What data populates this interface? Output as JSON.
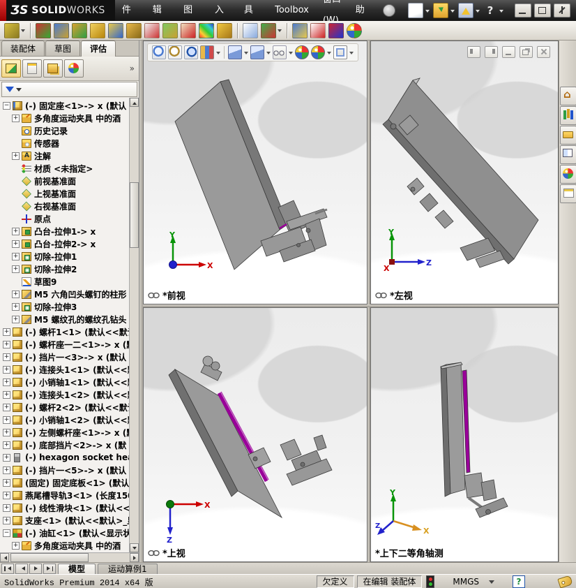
{
  "title_bar": {
    "logo_mark": "ƷS",
    "brand_bold": "SOLID",
    "brand_light": "WORKS",
    "menu_items": [
      "文件(F)",
      "编辑(E)",
      "视图(V)",
      "插入(I)",
      "工具(T)",
      "Toolbox",
      "窗口(W)",
      "帮助(H)"
    ],
    "pin_icon": "search-pin-icon",
    "quick_icons": [
      {
        "name": "new-document-icon",
        "cls": "qk-new",
        "dropdown": true
      },
      {
        "name": "open-document-icon",
        "cls": "qk-open",
        "dropdown": true
      },
      {
        "name": "options-warning-icon",
        "cls": "qk-warn",
        "dropdown": true
      },
      {
        "name": "help-icon",
        "cls": "qk-help",
        "glyph": "?",
        "dropdown": true
      }
    ],
    "window_buttons": [
      "minimize-icon",
      "maximize-icon",
      "close-icon"
    ]
  },
  "command_toolbar": {
    "icons": [
      {
        "name": "interchange-keys-icon",
        "c1": "#d8c040",
        "c2": "#8a7a20",
        "dropdown": true
      },
      {
        "name": "interference-detection-icon",
        "c1": "#cc3333",
        "c2": "#33aa33",
        "sep_before": true
      },
      {
        "name": "clearance-verification-icon",
        "c1": "#4a7ad0",
        "c2": "#c8a030"
      },
      {
        "name": "hole-alignment-icon",
        "c1": "#d8a030",
        "c2": "#2f9e44"
      },
      {
        "name": "measure-icon",
        "c1": "#f0d060",
        "c2": "#b8860b"
      },
      {
        "name": "mass-properties-icon",
        "c1": "#e8c84a",
        "c2": "#3366cc"
      },
      {
        "name": "section-properties-icon",
        "c1": "#e8b84a",
        "c2": "#8a6a18"
      },
      {
        "name": "performance-evaluation-icon",
        "c1": "#f0f0f0",
        "c2": "#cc3333"
      },
      {
        "name": "assembly-xpert-icon",
        "c1": "#80c860",
        "c2": "#c8a030"
      },
      {
        "name": "simulation-xpert-icon",
        "c1": "#f0e0c0",
        "c2": "#cc2222"
      },
      {
        "name": "curvature-icon",
        "special": "tb-rainbow"
      },
      {
        "name": "check-document-bell-icon",
        "c1": "#f0c840",
        "c2": "#a87818"
      },
      {
        "name": "compare-documents-icon",
        "c1": "#ffffff",
        "c2": "#88aadd",
        "sep_before": true
      },
      {
        "name": "design-checker-icon",
        "c1": "#3fae49",
        "c2": "#cc3333",
        "dropdown": true
      },
      {
        "name": "appearance-spray-icon",
        "c1": "#4a7ad0",
        "c2": "#e8c84a",
        "sep_before": true
      },
      {
        "name": "ring-light-icon",
        "c1": "#ffffff",
        "c2": "#cc2222"
      },
      {
        "name": "red-blue-squares-icon",
        "c1": "#cc2233",
        "c2": "#2233cc"
      },
      {
        "name": "realview-sphere-icon",
        "special": "tb-sphere"
      }
    ]
  },
  "left_panel": {
    "tabs": [
      {
        "label": "装配体",
        "active": false
      },
      {
        "label": "草图",
        "active": false
      },
      {
        "label": "评估",
        "active": true
      }
    ],
    "manager_icons": [
      {
        "name": "featuremanager-tree-icon",
        "cls": "fm-tree",
        "active": true
      },
      {
        "name": "propertymanager-icon",
        "cls": "fm-prop",
        "active": false
      },
      {
        "name": "configurationmanager-icon",
        "cls": "fm-config",
        "active": false
      },
      {
        "name": "displaymanager-icon",
        "cls": "fm-display",
        "active": false
      }
    ],
    "overflow_chevron": "»",
    "filter_icon": "filter-funnel-icon"
  },
  "tree": {
    "items": [
      {
        "label": "(-) 固定座<1>-> x  (默认",
        "icon": "part-edit",
        "expand": "minus",
        "indent": 0
      },
      {
        "label": "多角度运动夹具 中的酒",
        "icon": "folder-sketch",
        "expand": "plus",
        "indent": 1
      },
      {
        "label": "历史记录",
        "icon": "history",
        "expand": "none",
        "indent": 1
      },
      {
        "label": "传感器",
        "icon": "sensors",
        "expand": "none",
        "indent": 1
      },
      {
        "label": "注解",
        "icon": "annotations",
        "expand": "plus",
        "indent": 1
      },
      {
        "label": "材质 <未指定>",
        "icon": "material",
        "expand": "none",
        "indent": 1
      },
      {
        "label": "前视基准面",
        "icon": "plane",
        "expand": "none",
        "indent": 1
      },
      {
        "label": "上视基准面",
        "icon": "plane",
        "expand": "none",
        "indent": 1
      },
      {
        "label": "右视基准面",
        "icon": "plane",
        "expand": "none",
        "indent": 1
      },
      {
        "label": "原点",
        "icon": "origin",
        "expand": "none",
        "indent": 1
      },
      {
        "label": "凸台-拉伸1-> x",
        "icon": "boss-extrude",
        "expand": "plus",
        "indent": 1
      },
      {
        "label": "凸台-拉伸2-> x",
        "icon": "boss-extrude",
        "expand": "plus",
        "indent": 1
      },
      {
        "label": "切除-拉伸1",
        "icon": "cut-extrude",
        "expand": "plus",
        "indent": 1
      },
      {
        "label": "切除-拉伸2",
        "icon": "cut-extrude",
        "expand": "plus",
        "indent": 1
      },
      {
        "label": "草图9",
        "icon": "sketch",
        "expand": "none",
        "indent": 1
      },
      {
        "label": "M5 六角凹头螺钉的柱形",
        "icon": "hole-wizard",
        "expand": "plus",
        "indent": 1
      },
      {
        "label": "切除-拉伸3",
        "icon": "cut-extrude",
        "expand": "plus",
        "indent": 1
      },
      {
        "label": "M5 螺纹孔的螺纹孔钻头",
        "icon": "hole-wizard",
        "expand": "plus",
        "indent": 1
      },
      {
        "label": "(-) 螺杆1<1> (默认<<默认",
        "icon": "part",
        "expand": "plus",
        "indent": 0
      },
      {
        "label": "(-) 螺杆座一二<1>-> x  (默",
        "icon": "part",
        "expand": "plus",
        "indent": 0
      },
      {
        "label": "(-) 挡片一<3>-> x  (默认",
        "icon": "part",
        "expand": "plus",
        "indent": 0
      },
      {
        "label": "(-) 连接头1<1> (默认<<默",
        "icon": "part",
        "expand": "plus",
        "indent": 0
      },
      {
        "label": "(-) 小销轴1<1> (默认<<默",
        "icon": "part",
        "expand": "plus",
        "indent": 0
      },
      {
        "label": "(-) 连接头1<2> (默认<<默",
        "icon": "part",
        "expand": "plus",
        "indent": 0
      },
      {
        "label": "(-) 螺杆2<2> (默认<<默认",
        "icon": "part",
        "expand": "plus",
        "indent": 0
      },
      {
        "label": "(-) 小销轴1<2> (默认<<默",
        "icon": "part",
        "expand": "plus",
        "indent": 0
      },
      {
        "label": "(-) 左侧螺杆座<1>-> x  (默",
        "icon": "part",
        "expand": "plus",
        "indent": 0
      },
      {
        "label": "(-) 底部挡片<2>-> x  (默",
        "icon": "part",
        "expand": "plus",
        "indent": 0
      },
      {
        "label": "(-) hexagon socket head",
        "icon": "bolt",
        "expand": "plus",
        "indent": 0
      },
      {
        "label": "(-) 挡片一<5>-> x  (默认",
        "icon": "part",
        "expand": "plus",
        "indent": 0
      },
      {
        "label": "(固定) 固定底板<1> (默认",
        "icon": "part",
        "expand": "plus",
        "indent": 0
      },
      {
        "label": "燕尾槽导轨3<1> (长度150",
        "icon": "part",
        "expand": "plus",
        "indent": 0
      },
      {
        "label": "(-) 线性滑块<1> (默认<<",
        "icon": "part",
        "expand": "plus",
        "indent": 0
      },
      {
        "label": "支座<1> (默认<<默认>_显",
        "icon": "part",
        "expand": "plus",
        "indent": 0
      },
      {
        "label": "(-) 油缸<1> (默认<显示状",
        "icon": "subassembly",
        "expand": "minus",
        "indent": 0
      },
      {
        "label": "多角度运动夹具 中的酒",
        "icon": "folder-sketch",
        "expand": "plus",
        "indent": 1
      }
    ]
  },
  "headsup_toolbar": {
    "icons": [
      {
        "name": "zoom-fit-icon",
        "cls": "hu-zoom-fit"
      },
      {
        "name": "zoom-area-icon",
        "cls": "hu-zoom-area"
      },
      {
        "name": "previous-view-icon",
        "cls": "hu-previous-view"
      },
      {
        "name": "section-view-icon",
        "cls": "hu-section-view",
        "dropdown": true
      },
      {
        "name": "view-orientation-icon",
        "cls": "hu-view-orientation",
        "dropdown": true,
        "sep_before": true
      },
      {
        "name": "display-style-icon",
        "cls": "hu-display-style",
        "dropdown": true
      },
      {
        "name": "hide-show-items-icon",
        "cls": "hu-hide-show",
        "dropdown": true
      },
      {
        "name": "edit-appearance-icon",
        "cls": "hu-edit-appearance"
      },
      {
        "name": "apply-scene-icon",
        "cls": "hu-apply-scene",
        "dropdown": true
      },
      {
        "name": "view-settings-icon",
        "cls": "hu-view-settings",
        "dropdown": true
      }
    ]
  },
  "doc_window": {
    "controls": [
      "pane-left-icon",
      "pane-right-icon",
      "minimize-icon",
      "restore-icon",
      "close-icon"
    ]
  },
  "viewports": [
    {
      "id": "front",
      "label": "*前视",
      "linked": true
    },
    {
      "id": "left",
      "label": "*左视",
      "linked": true
    },
    {
      "id": "top",
      "label": "*上视",
      "linked": true
    },
    {
      "id": "dimetric",
      "label": "*上下二等角轴测",
      "linked": false
    }
  ],
  "task_pane": {
    "icons": [
      "home-icon",
      "design-library-icon",
      "file-explorer-icon",
      "view-palette-icon",
      "appearances-icon",
      "custom-properties-icon"
    ]
  },
  "motion_bar": {
    "nav_icons": [
      "first-study-icon",
      "previous-study-icon",
      "next-study-icon",
      "last-study-icon"
    ],
    "tabs": [
      {
        "label": "模型",
        "active": true
      },
      {
        "label": "运动算例1",
        "active": false
      }
    ]
  },
  "status_bar": {
    "app_version": "SolidWorks Premium 2014 x64 版",
    "definition_state": "欠定义",
    "edit_state": "在编辑 装配体",
    "units": "MMGS",
    "help_glyph": "?",
    "icons": [
      "traffic-light-icon",
      "units-caret-icon",
      "help-badge-icon",
      "tag-icon"
    ]
  },
  "colors": {
    "model_gray": "#9a9a9a",
    "model_dark": "#6f6f6f",
    "model_light": "#c2c2c2",
    "edge": "#3a3a3a",
    "leadscrew_magenta": "#990099",
    "axis_x": "#cc0000",
    "axis_y": "#089408",
    "axis_z": "#2222cc",
    "axis_x_dimetric": "#d89020"
  }
}
